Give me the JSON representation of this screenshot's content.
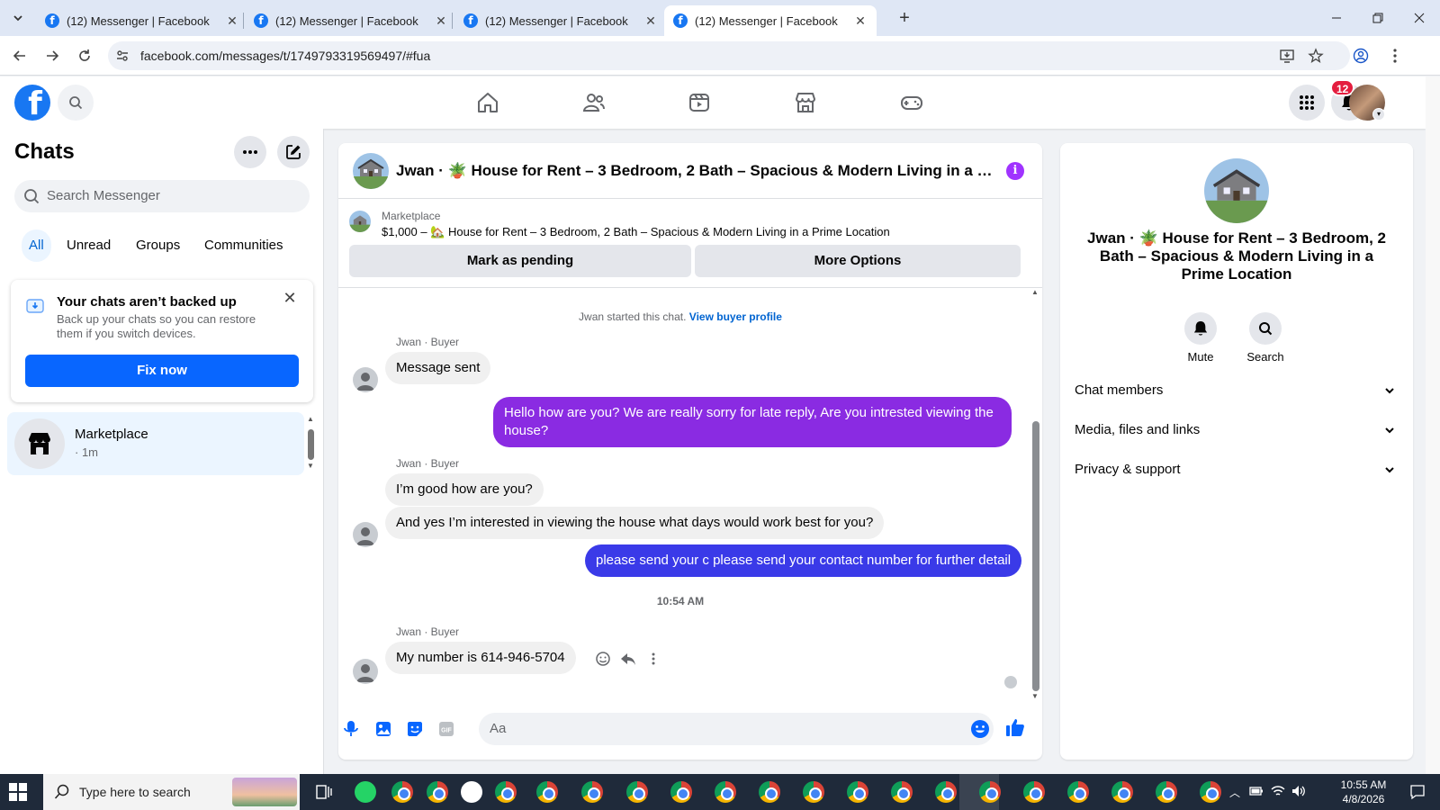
{
  "browser": {
    "tabs": [
      {
        "title": "(12) Messenger | Facebook",
        "active": false
      },
      {
        "title": "(12) Messenger | Facebook",
        "active": false
      },
      {
        "title": "(12) Messenger | Facebook",
        "active": false
      },
      {
        "title": "(12) Messenger | Facebook",
        "active": true
      }
    ],
    "new_tab_symbol": "+",
    "url": "facebook.com/messages/t/1749793319569497/#fua"
  },
  "fb_header": {
    "logo_letter": "f",
    "notification_count": "12",
    "nav_icons": [
      "home-icon",
      "friends-icon",
      "video-icon",
      "marketplace-icon",
      "gaming-icon"
    ]
  },
  "sidebar": {
    "title": "Chats",
    "search_placeholder": "Search Messenger",
    "filters": [
      "All",
      "Unread",
      "Groups",
      "Communities"
    ],
    "active_filter": "All",
    "backup_card": {
      "title": "Your chats aren’t backed up",
      "description": "Back up your chats so you can restore them if you switch devices.",
      "button": "Fix now"
    },
    "chats": [
      {
        "name": "Marketplace",
        "time": "· 1m",
        "selected": true
      }
    ]
  },
  "conversation": {
    "header_title": "Jwan · 🪴 House for Rent – 3 Bedroom, 2 Bath – Spacious & Modern Living in a Prime Location",
    "marketplace_label": "Marketplace",
    "listing": "$1,000 – 🏡 House for Rent – 3 Bedroom, 2 Bath – Spacious & Modern Living in a Prime Location",
    "actions": [
      "Mark as pending",
      "More Options"
    ],
    "system_text": "Jwan started this chat.",
    "system_link": "View buyer profile",
    "messages": [
      {
        "sender": "Jwan · Buyer",
        "text": "Message sent",
        "dir": "in"
      },
      {
        "text": "Hello how are you? We are really sorry for late reply, Are you intrested viewing the house?",
        "dir": "out",
        "color": "#8a2be2"
      },
      {
        "sender": "Jwan · Buyer",
        "text": "I’m good how are you?",
        "dir": "in"
      },
      {
        "text": "And yes I’m interested in viewing the house what days would work best for you?",
        "dir": "in"
      },
      {
        "text": "please send your c please send your contact number for further detail",
        "dir": "out",
        "color": "#3a3ae8"
      },
      {
        "timestamp": "10:54 AM"
      },
      {
        "sender": "Jwan · Buyer",
        "text": "My number is 614-946-5704",
        "dir": "in"
      }
    ],
    "composer_placeholder": "Aa"
  },
  "info_panel": {
    "title": "Jwan · 🪴 House for Rent – 3 Bedroom, 2 Bath – Spacious & Modern Living in a Prime Location",
    "actions": [
      "Mute",
      "Search"
    ],
    "sections": [
      "Chat members",
      "Media, files and links",
      "Privacy & support"
    ]
  },
  "taskbar": {
    "search_placeholder": "Type here to search",
    "time": "10:55 AM",
    "date": "4/8/2026"
  },
  "colors": {
    "fb_blue": "#1877f2",
    "button_blue": "#0866ff",
    "outgoing_purple": "#8a2be2",
    "outgoing_blue": "#3a3ae8",
    "info_purple": "#a033ff",
    "badge_red": "#e41e3f"
  }
}
